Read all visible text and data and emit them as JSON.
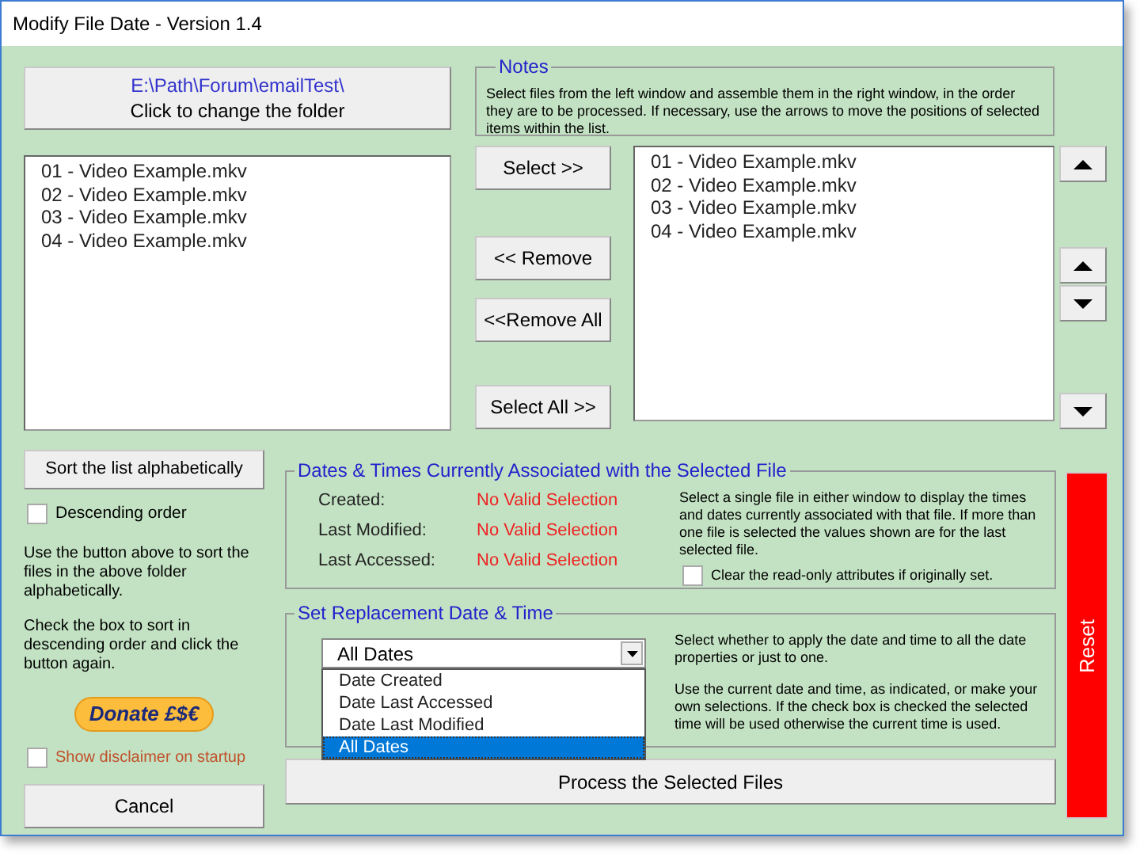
{
  "window": {
    "title": "Modify File Date - Version 1.4"
  },
  "folder_button": {
    "path": "E:\\Path\\Forum\\emailTest\\",
    "label": "Click to change the folder"
  },
  "source_list": {
    "items": [
      "01 - Video Example.mkv",
      "02 - Video Example.mkv",
      "03 - Video Example.mkv",
      "04 - Video Example.mkv"
    ]
  },
  "notes": {
    "title": "Notes",
    "text": "Select files from the left window and assemble them in the right window, in the order they are to be processed. If necessary, use the arrows to move the positions of selected items within the list."
  },
  "transfer_buttons": [
    "Select >>",
    "<< Remove",
    "<<Remove All",
    "Select All >>"
  ],
  "target_list": {
    "items": [
      "01 - Video Example.mkv",
      "02 - Video Example.mkv",
      "03 - Video Example.mkv",
      "04 - Video Example.mkv"
    ]
  },
  "arrow_buttons": [
    {
      "kind": "up"
    },
    {
      "kind": "up"
    },
    {
      "kind": "down"
    },
    {
      "kind": "down"
    }
  ],
  "sort_button": "Sort the list alphabetically",
  "descending_checkbox": {
    "label": "Descending order",
    "checked": false
  },
  "sort_help": [
    "Use the button above to sort the files in the above folder alphabetically.",
    "Check the box to sort in descending order and click the button again."
  ],
  "donate_button": "Donate £$€",
  "disclaimer_checkbox": {
    "label": "Show disclaimer on startup",
    "checked": false
  },
  "cancel_button": "Cancel",
  "dates_group": {
    "title": "Dates & Times Currently Associated with the Selected File",
    "rows": [
      {
        "label": "Created:",
        "value": "No Valid Selection"
      },
      {
        "label": "Last Modified:",
        "value": "No Valid Selection"
      },
      {
        "label": "Last Accessed:",
        "value": "No Valid Selection"
      }
    ],
    "help": "Select a single file in either window to display the times and dates currently associated with that file. If more than one file is selected the values shown are for the last selected file.",
    "readonly_checkbox": {
      "label": "Clear the read-only attributes if originally set.",
      "checked": false
    }
  },
  "replacement_group": {
    "title": "Set Replacement Date & Time",
    "dropdown": {
      "value": "All Dates",
      "options": [
        {
          "label": "Date Created",
          "selected": false
        },
        {
          "label": "Date Last Accessed",
          "selected": false
        },
        {
          "label": "Date Last Modified",
          "selected": false
        },
        {
          "label": "All Dates",
          "selected": true
        }
      ]
    },
    "help": [
      "Select whether to apply the date and time to all the date properties or just to one.",
      "Use the current date and time, as indicated, or make your own selections. If the check box is checked the selected time will be used otherwise the current time is used."
    ]
  },
  "process_button": "Process the Selected Files",
  "reset_button": "Reset"
}
